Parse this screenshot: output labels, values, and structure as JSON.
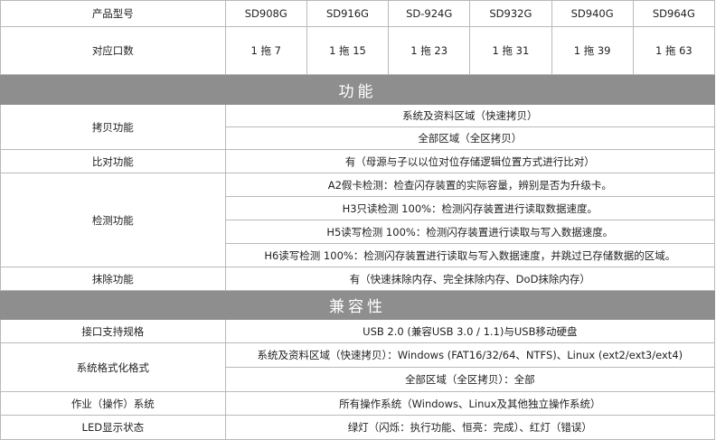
{
  "header": {
    "label": "产品型号",
    "models": [
      "SD908G",
      "SD916G",
      "SD-924G",
      "SD932G",
      "SD940G",
      "SD964G"
    ]
  },
  "ports": {
    "label": "对应口数",
    "values": [
      "1 拖 7",
      "1 拖 15",
      "1 拖 23",
      "1 拖 31",
      "1 拖 39",
      "1 拖 63"
    ]
  },
  "section_function": "功能",
  "copy": {
    "label": "拷贝功能",
    "items": [
      "系统及资料区域（快速拷贝）",
      "全部区域（全区拷贝）"
    ]
  },
  "compare": {
    "label": "比对功能",
    "value": "有（母源与子以以位对位存储逻辑位置方式进行比对）"
  },
  "detect": {
    "label": "检测功能",
    "items": [
      "A2假卡检测：检查闪存装置的实际容量，辨别是否为升级卡。",
      "H3只读检测 100%：检测闪存装置进行读取数据速度。",
      "H5读写检测 100%：检测闪存装置进行读取与写入数据速度。",
      "H6读写检测 100%：检测闪存装置进行读取与写入数据速度，并跳过已存储数据的区域。"
    ]
  },
  "erase": {
    "label": "抹除功能",
    "value": "有（快速抹除内存、完全抹除内存、DoD抹除内存）"
  },
  "section_compat": "兼容性",
  "interface": {
    "label": "接口支持规格",
    "value": "USB 2.0 (兼容USB 3.0 / 1.1)与USB移动硬盘"
  },
  "format": {
    "label": "系统格式化格式",
    "items": [
      "系统及资料区域（快速拷贝）：Windows (FAT16/32/64、NTFS)、Linux (ext2/ext3/ext4)",
      "全部区域（全区拷贝）：全部"
    ]
  },
  "os": {
    "label": "作业（操作）系统",
    "value": "所有操作系统（Windows、Linux及其他独立操作系统）"
  },
  "led": {
    "label": "LED显示状态",
    "value": "绿灯（闪烁：执行功能、恒亮：完成）、红灯（错误）"
  }
}
